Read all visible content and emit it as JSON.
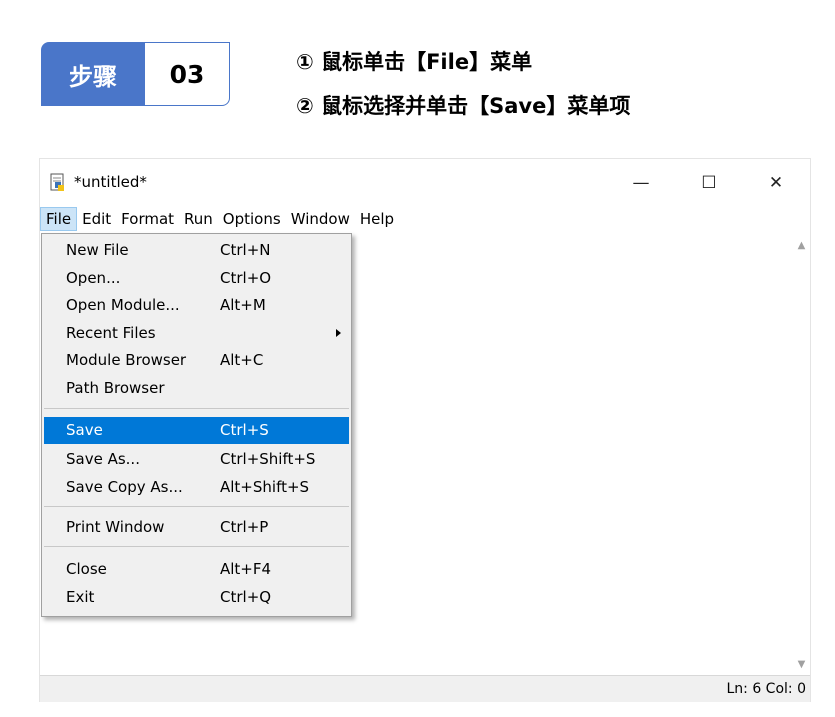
{
  "step": {
    "label": "步骤",
    "number": "03"
  },
  "instructions": [
    "① 鼠标单击【File】菜单",
    "② 鼠标选择并单击【Save】菜单项"
  ],
  "window": {
    "title": "*untitled*",
    "controls": {
      "minimize": "—",
      "maximize": "☐",
      "close": "✕"
    }
  },
  "menubar": [
    "File",
    "Edit",
    "Format",
    "Run",
    "Options",
    "Window",
    "Help"
  ],
  "file_menu": [
    {
      "label": "New File",
      "accel": "Ctrl+N"
    },
    {
      "label": "Open...",
      "accel": "Ctrl+O"
    },
    {
      "label": "Open Module...",
      "accel": "Alt+M"
    },
    {
      "label": "Recent Files",
      "accel": "",
      "submenu": true
    },
    {
      "label": "Module Browser",
      "accel": "Alt+C"
    },
    {
      "label": "Path Browser",
      "accel": ""
    },
    {
      "label": "Save",
      "accel": "Ctrl+S",
      "highlighted": true
    },
    {
      "label": "Save As...",
      "accel": "Ctrl+Shift+S"
    },
    {
      "label": "Save Copy As...",
      "accel": "Alt+Shift+S"
    },
    {
      "label": "Print Window",
      "accel": "Ctrl+P"
    },
    {
      "label": "Close",
      "accel": "Alt+F4"
    },
    {
      "label": "Exit",
      "accel": "Ctrl+Q"
    }
  ],
  "status": "Ln: 6  Col: 0",
  "colors": {
    "step_blue": "#4a76c9",
    "menu_highlight": "#0078d7",
    "menu_bg": "#f0f0f0"
  }
}
